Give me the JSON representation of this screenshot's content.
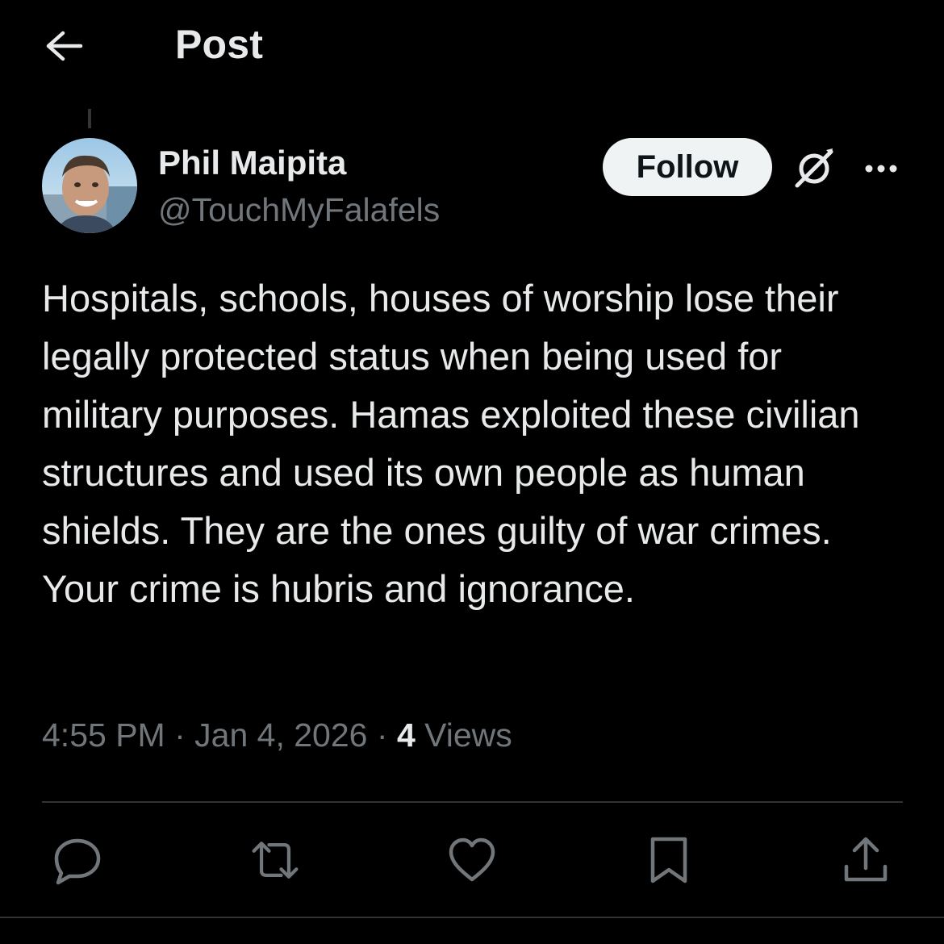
{
  "header": {
    "title": "Post",
    "back_icon": "arrow-left-icon"
  },
  "author": {
    "display_name": "Phil Maipita",
    "handle": "@TouchMyFalafels",
    "avatar_icon": "avatar"
  },
  "actions_top": {
    "follow_label": "Follow",
    "grok_icon": "grok-icon",
    "more_icon": "more-icon"
  },
  "post": {
    "text": "Hospitals, schools, houses of worship lose their legally protected status when being used for military purposes. Hamas exploited these civilian structures and used its own people as human shields. They are the ones guilty of war crimes. Your crime is hubris and ignorance."
  },
  "meta": {
    "time": "4:55 PM",
    "separator": "·",
    "date": "Jan 4, 2026",
    "views_count": "4",
    "views_label": "Views"
  },
  "engagement": {
    "reply_icon": "reply-icon",
    "repost_icon": "repost-icon",
    "like_icon": "like-icon",
    "bookmark_icon": "bookmark-icon",
    "share_icon": "share-icon"
  },
  "colors": {
    "background": "#000000",
    "text_primary": "#e7e9ea",
    "text_secondary": "#71767b",
    "divider": "#2f3336",
    "follow_bg": "#eff3f4"
  }
}
